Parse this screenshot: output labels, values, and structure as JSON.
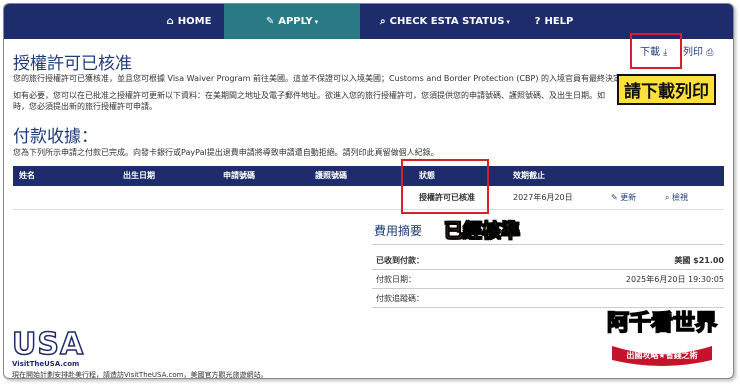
{
  "nav": {
    "home": "HOME",
    "apply": "APPLY",
    "check": "CHECK ESTA STATUS",
    "help": "HELP"
  },
  "page": {
    "title": "授權許可已核准",
    "para1": "您的旅行授權許可已獲核准，並且您可根據 Visa Waiver Program 前往美國。這並不保證可以入境美國；Customs and Border Protection (CBP) 的入境官員有最終決定權",
    "para2a": "如有必要，您可以在已批准之授權許可更新以下資料：在美期間之地址及電子郵件地址。欲進入您的旅行授權許可，您須提供您的申請號碼、護照號碼、及出生日期。如",
    "para2b": "時，您必須提出新的旅行授權許可申請。",
    "download": "下載",
    "print": "列印"
  },
  "payment": {
    "title": "付款收據：",
    "para": "您為下列所示申請之付款已完成。向發卡銀行或PayPal提出退費申請將導致申請遭自動拒絕。請列印此頁留做個人紀錄。"
  },
  "table": {
    "headers": [
      "姓名",
      "出生日期",
      "申請號碼",
      "護照號碼",
      "狀態",
      "效期截止"
    ],
    "row": {
      "status": "授權許可已核准",
      "expiry": "2027年6月20日",
      "update": "更新",
      "view": "檢視"
    }
  },
  "summary": {
    "title": "費用摘要",
    "paid_label": "已收到付款：",
    "paid_value": "美國 $21.00",
    "date_label": "付款日期：",
    "date_value": "2025年6月20日 19:30:05",
    "tracking_label": "付款追蹤碼："
  },
  "annotations": {
    "download_print": "請下載列印",
    "approved": "已經核準"
  },
  "logo": {
    "text": "USA",
    "site": "VisitTheUSA.com"
  },
  "footer": "現在開始計劃安排赴美行程，請造訪VisitTheUSA.com，美國官方觀光旅遊網站。",
  "brand": {
    "name": "阿千看世界",
    "tagline": "出國攻略★省錢之術"
  },
  "colors": {
    "navbar": "#1f2c6b",
    "nav_active": "#2a7a86",
    "highlight_red": "#d81f2a",
    "callout_yellow": "#ffe13a"
  }
}
